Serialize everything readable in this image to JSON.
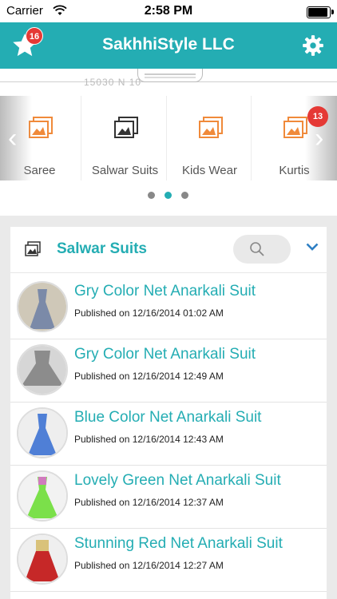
{
  "status_bar": {
    "carrier": "Carrier",
    "time": "2:58 PM"
  },
  "header": {
    "title": "SakhhiStyle LLC",
    "favorites_badge": "16",
    "accent_color": "#24adb3"
  },
  "banner": {
    "address_fragment": "15030 N          10"
  },
  "categories": [
    {
      "label": "Saree",
      "icon": "image-icon",
      "color": "#f08a3a"
    },
    {
      "label": "Salwar Suits",
      "icon": "image-icon",
      "color": "#333333"
    },
    {
      "label": "Kids Wear",
      "icon": "image-icon",
      "color": "#f08a3a"
    },
    {
      "label": "Kurtis",
      "icon": "image-icon",
      "color": "#f08a3a",
      "badge": "13"
    }
  ],
  "pager": {
    "pages": 3,
    "active": 1
  },
  "section": {
    "title": "Salwar Suits",
    "search_icon": "search-icon",
    "toggle_icon": "chevron-down-icon"
  },
  "items": [
    {
      "title": "Gry Color Net Anarkali Suit",
      "date": "Published on 12/16/2014 01:02 AM",
      "dress_color": "#7b8aa8"
    },
    {
      "title": "Gry Color Net Anarkali Suit",
      "date": "Published on 12/16/2014 12:49 AM",
      "dress_color": "#8c8c8c"
    },
    {
      "title": "Blue Color Net Anarkali Suit",
      "date": "Published on 12/16/2014 12:43 AM",
      "dress_color": "#4f7fd6"
    },
    {
      "title": "Lovely Green Net Anarkali Suit",
      "date": "Published on 12/16/2014 12:37 AM",
      "dress_color": "#7be04a"
    },
    {
      "title": "Stunning Red Net Anarkali Suit",
      "date": "Published on 12/16/2014 12:27 AM",
      "dress_color": "#c62828"
    }
  ]
}
